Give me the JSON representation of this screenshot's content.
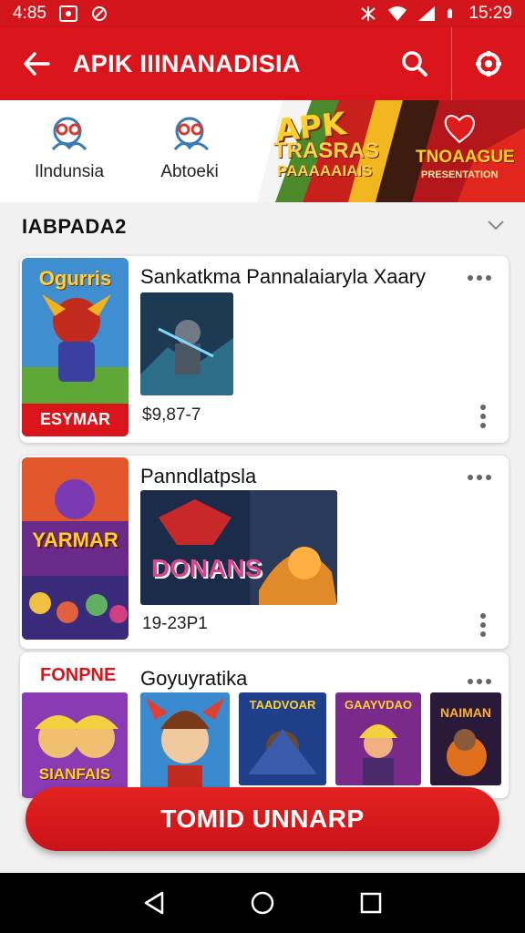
{
  "status_bar": {
    "time_left": "4:85",
    "time_right": "15:29"
  },
  "app_bar": {
    "title": "APIK IIINANADISIA"
  },
  "categories": [
    {
      "label": "Ilndunsia",
      "icon": "people-icon"
    },
    {
      "label": "Abtoeki",
      "icon": "people-icon"
    }
  ],
  "promo": {
    "title": "APK",
    "line1": "TRASRAS",
    "line2": "PAAAAAIAIS",
    "right_title": "TNOAAGUE",
    "right_sub": "PRESENTATION"
  },
  "section": {
    "title": "IABPADA2"
  },
  "cards": [
    {
      "title": "Sankatkma  Pannalaiaryla Xaary",
      "price": "$9,87-7",
      "poster_title": "Ogurris",
      "poster_badge": "ESYMAR"
    },
    {
      "title": "Panndlatpsla",
      "price": "19-23P1",
      "poster_title": "YARMAR",
      "shot_title": "DONANS"
    },
    {
      "title": "Goyuyratika",
      "poster_title": "FONPNE",
      "thumb_label": "SIANFAIS",
      "thumb_titles": [
        "TAADVOAR",
        "GAAYVDAO",
        "NAIMAN"
      ]
    }
  ],
  "cta": {
    "label": "TOMID UNNARP"
  },
  "colors": {
    "accent": "#d9151b",
    "bar": "#d2161c"
  }
}
